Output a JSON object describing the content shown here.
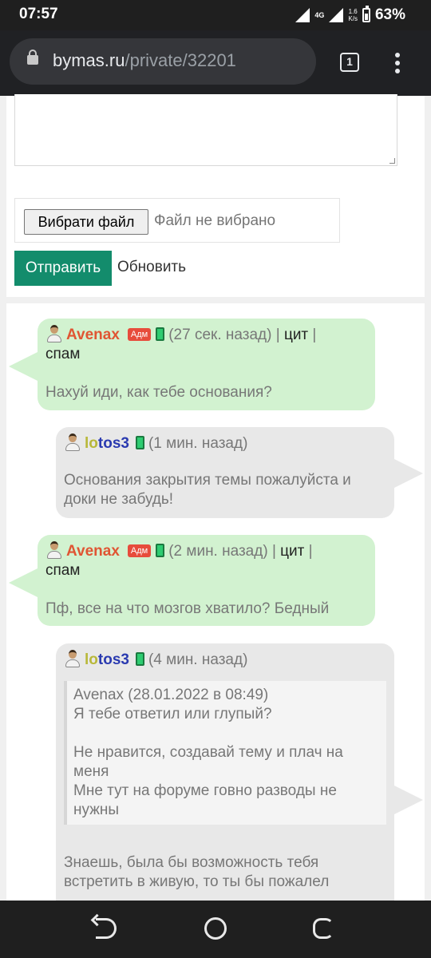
{
  "status_bar": {
    "time": "07:57",
    "network": "4G",
    "speed_value": "1.6",
    "speed_unit": "K/s",
    "battery": "63%"
  },
  "browser": {
    "url_host": "bymas.ru",
    "url_path": "/private/32201",
    "tab_count": "1"
  },
  "form": {
    "file_button": "Вибрати файл",
    "file_status": "Файл не вибрано",
    "send_button": "Отправить",
    "refresh_link": "Обновить"
  },
  "messages": [
    {
      "user_part1": "Avenax",
      "badge": "Адм",
      "time": "(27 сек. назад)",
      "sep1": "|",
      "quote_action": "цит",
      "sep2": "|",
      "spam_action": "спам",
      "text": "Нахуй иди, как тебе основания?"
    },
    {
      "user_part1": "lo",
      "user_part2": "tos3",
      "time": "(1 мин. назад)",
      "text": "Основания закрытия темы пожалуйста и доки не забудь!"
    },
    {
      "user_part1": "Avenax",
      "badge": "Адм",
      "time": "(2 мин. назад)",
      "sep1": "|",
      "quote_action": "цит",
      "sep2": "|",
      "spam_action": "спам",
      "text": "Пф, все на что мозгов хватило? Бедный"
    },
    {
      "user_part1": "lo",
      "user_part2": "tos3",
      "time": "(4 мин. назад)",
      "quote": {
        "author": "Avenax (28.01.2022 в 08:49)",
        "line1": "Я тебе ответил или глупый?",
        "line2": "Не нравится, создавай тему и плач на меня",
        "line3": "Мне тут на форуме говно разводы не нужны"
      },
      "text": "Знаешь, была бы возможность тебя встретить в живую, то ты бы пожалел"
    }
  ],
  "icons": {
    "avatar": "user-avatar-icon",
    "device": "mobile-phone-icon",
    "lock": "lock-icon",
    "menu": "more-vert-icon"
  },
  "colors": {
    "accent": "#138c6c",
    "admin_name": "#e05533",
    "badge": "#e74c3c",
    "bubble_green": "#d2f2d0",
    "bubble_grey": "#e8e8e8"
  }
}
